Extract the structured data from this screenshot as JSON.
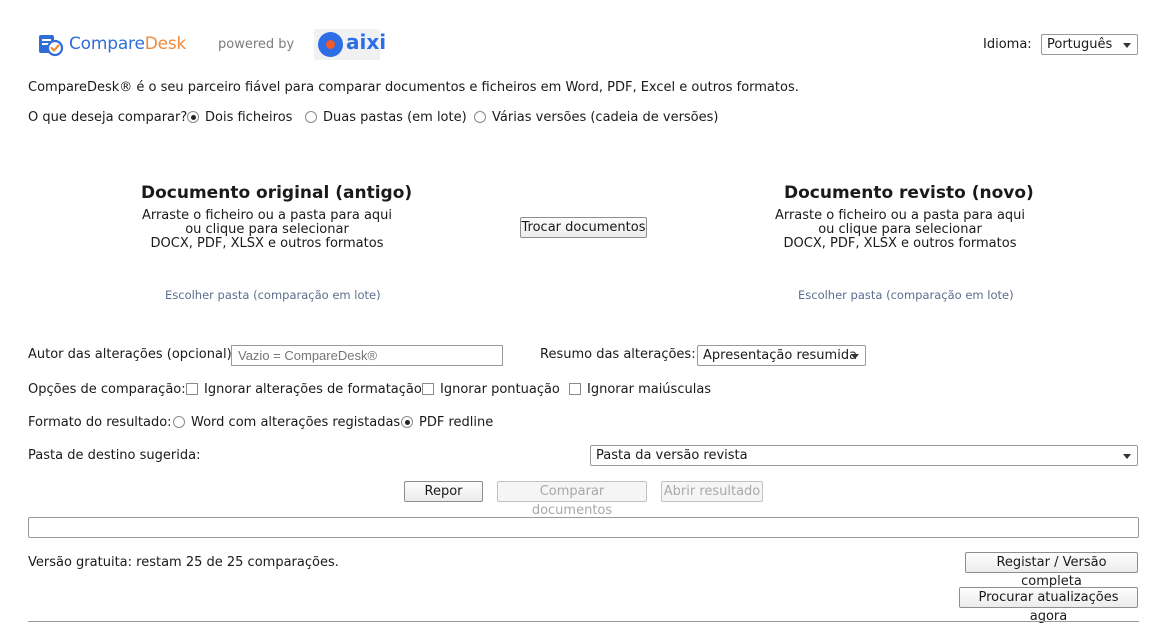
{
  "header": {
    "brand_part1": "Compare",
    "brand_part2": "Desk",
    "powered_by": "powered by",
    "partner_logo_text": "aixi",
    "language_label": "Idioma:",
    "language_value": "Português"
  },
  "intro": "CompareDesk® é o seu parceiro fiável para comparar documentos e ficheiros em Word, PDF, Excel e outros formatos.",
  "compare_mode": {
    "label": "O que deseja comparar?",
    "options": [
      "Dois ficheiros",
      "Duas pastas (em lote)",
      "Várias versões (cadeia de versões)"
    ],
    "selected": "Dois ficheiros"
  },
  "original": {
    "title": "Documento original (antigo)",
    "line1": "Arraste o ficheiro ou a pasta para aqui",
    "line2": "ou clique para selecionar",
    "line3": "DOCX, PDF, XLSX e outros formatos",
    "folder_link": "Escolher pasta (comparação em lote)"
  },
  "swap_button": "Trocar documentos",
  "revised": {
    "title": "Documento revisto (novo)",
    "line1": "Arraste o ficheiro ou a pasta para aqui",
    "line2": "ou clique para selecionar",
    "line3": "DOCX, PDF, XLSX e outros formatos",
    "folder_link": "Escolher pasta (comparação em lote)"
  },
  "author": {
    "label": "Autor das alterações (opcional):",
    "placeholder": "Vazio = CompareDesk®",
    "value": ""
  },
  "summary": {
    "label": "Resumo das alterações:",
    "value": "Apresentação resumida"
  },
  "options": {
    "label": "Opções de comparação:",
    "items": [
      {
        "label": "Ignorar alterações de formatação",
        "checked": false
      },
      {
        "label": "Ignorar pontuação",
        "checked": false
      },
      {
        "label": "Ignorar maiúsculas",
        "checked": false
      }
    ]
  },
  "output_format": {
    "label": "Formato do resultado:",
    "options": [
      "Word com alterações registadas",
      "PDF redline"
    ],
    "selected": "PDF redline"
  },
  "destination": {
    "label": "Pasta de destino sugerida:",
    "value": "Pasta da versão revista"
  },
  "actions": {
    "reset": "Repor",
    "compare": "Comparar documentos",
    "open_result": "Abrir resultado"
  },
  "progress_value": 0,
  "footer": {
    "status": "Versão gratuita: restam 25 de 25 comparações.",
    "register": "Registar / Versão completa",
    "updates": "Procurar atualizações agora"
  },
  "colors": {
    "brand_blue": "#2f6ed8",
    "brand_orange": "#f08a3c",
    "link": "#5b6f8f"
  }
}
